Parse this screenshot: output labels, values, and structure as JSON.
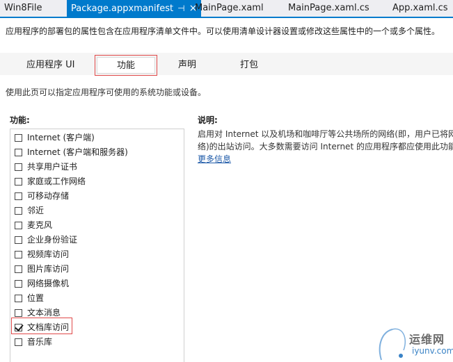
{
  "tabs": {
    "t1": "Win8File",
    "t2": "Package.appxmanifest",
    "t2_pin": "⊣",
    "t2_close": "×",
    "t3": "MainPage.xaml",
    "t4": "MainPage.xaml.cs",
    "t5": "App.xaml.cs"
  },
  "description": "应用程序的部署包的属性包含在应用程序清单文件中。可以使用清单设计器设置或修改这些属性中的一个或多个属性。",
  "page_tabs": {
    "ui": "应用程序 UI",
    "caps": "功能",
    "decl": "声明",
    "pkg": "打包"
  },
  "hint": "使用此页可以指定应用程序可使用的系统功能或设备。",
  "capabilities_label": "功能:",
  "capabilities": [
    {
      "label": "Internet (客户端)",
      "checked": false
    },
    {
      "label": "Internet (客户端和服务器)",
      "checked": false
    },
    {
      "label": "共享用户证书",
      "checked": false
    },
    {
      "label": "家庭或工作网络",
      "checked": false
    },
    {
      "label": "可移动存储",
      "checked": false
    },
    {
      "label": "邻近",
      "checked": false
    },
    {
      "label": "麦克风",
      "checked": false
    },
    {
      "label": "企业身份验证",
      "checked": false
    },
    {
      "label": "视频库访问",
      "checked": false
    },
    {
      "label": "图片库访问",
      "checked": false
    },
    {
      "label": "网络摄像机",
      "checked": false
    },
    {
      "label": "位置",
      "checked": false
    },
    {
      "label": "文本消息",
      "checked": false
    },
    {
      "label": "文档库访问",
      "checked": true
    },
    {
      "label": "音乐库",
      "checked": false
    }
  ],
  "description_panel": {
    "label": "说明:",
    "line1": "启用对 Internet 以及机场和咖啡厅等公共场所的网络(即，用户已将网",
    "line2": "络)的出站访问。大多数需要访问 Internet 的应用程序都应使用此功能",
    "more": "更多信息"
  },
  "watermark": {
    "line1": "运维网",
    "line2": "iyunv.com"
  }
}
